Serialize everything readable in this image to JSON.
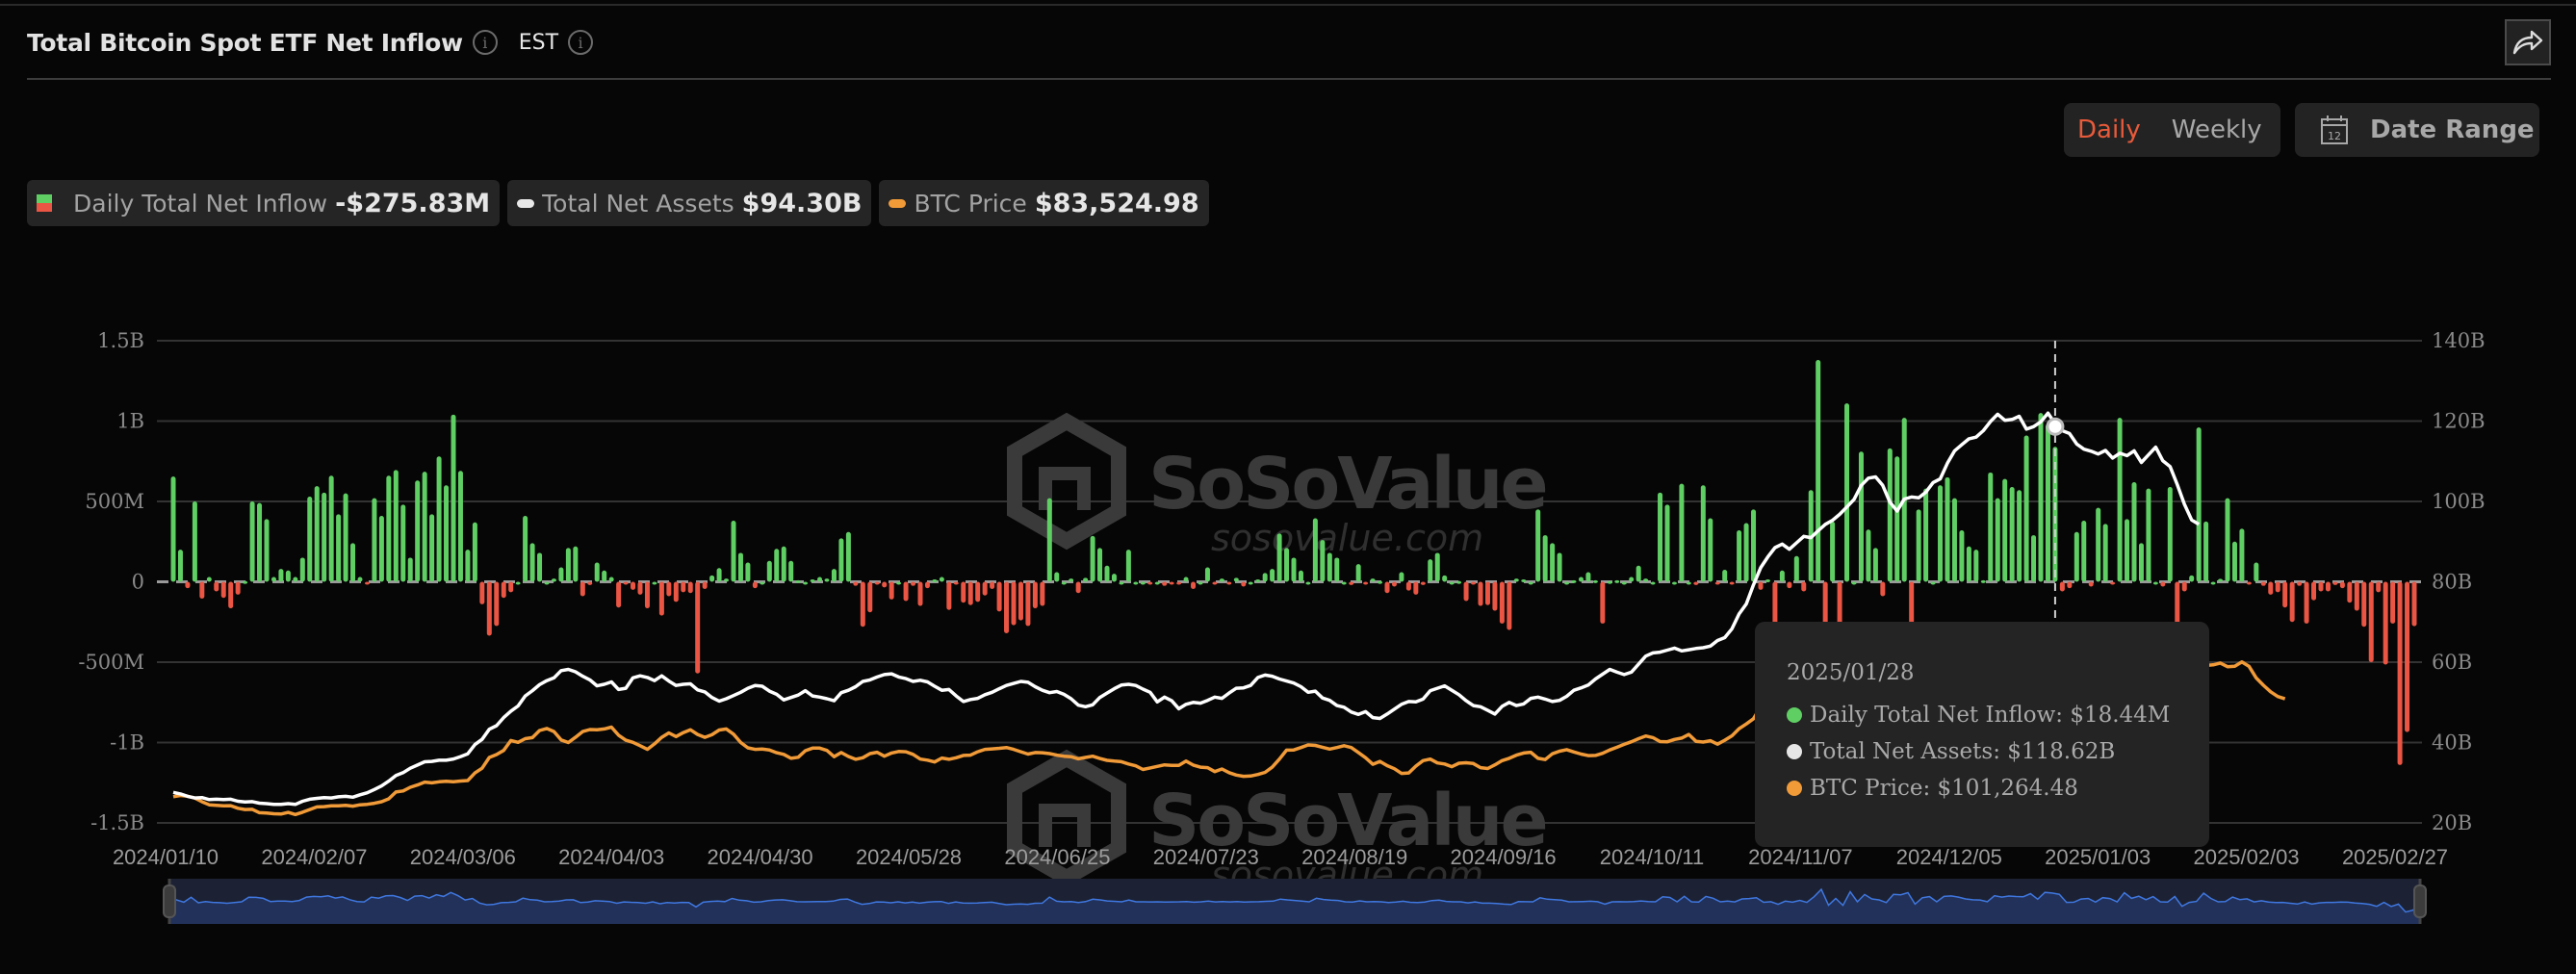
{
  "header": {
    "title": "Total Bitcoin Spot ETF Net Inflow",
    "timezone": "EST",
    "share_icon": "share-arrow-icon",
    "info_icon": "info-circle-icon"
  },
  "controls": {
    "granularity": [
      {
        "label": "Daily",
        "active": true
      },
      {
        "label": "Weekly",
        "active": false
      }
    ],
    "date_range_label": "Date Range",
    "date_range_icon": "calendar-icon"
  },
  "legend": [
    {
      "label": "Daily Total Net Inflow",
      "value": "-$275.83M"
    },
    {
      "label": "Total Net Assets",
      "value": "$94.30B"
    },
    {
      "label": "BTC Price",
      "value": "$83,524.98"
    }
  ],
  "colors": {
    "inflow_positive": "#5fcf64",
    "inflow_negative": "#ea5544",
    "total_net_assets": "#ffffff",
    "btc_price": "#f19a38",
    "active_toggle": "#e85a3a",
    "minimap_fill": "#223159",
    "minimap_line": "#3f77e0"
  },
  "tooltip": {
    "date": "2025/01/28",
    "rows": [
      {
        "label": "Daily Total Net Inflow: $18.44M",
        "color": "#5fcf64"
      },
      {
        "label": "Total Net Assets: $118.62B",
        "color": "#e6e6e6"
      },
      {
        "label": "BTC Price: $101,264.48",
        "color": "#f19a38"
      }
    ]
  },
  "watermark": {
    "brand": "SoSoValue",
    "url": "sosovalue.com"
  },
  "chart_data": {
    "type": "bar",
    "title": "Total Bitcoin Spot ETF Net Inflow",
    "x_tick_labels": [
      "2024/01/10",
      "2024/02/07",
      "2024/03/06",
      "2024/04/03",
      "2024/04/30",
      "2024/05/28",
      "2024/06/25",
      "2024/07/23",
      "2024/08/19",
      "2024/09/16",
      "2024/10/11",
      "2024/11/07",
      "2024/12/05",
      "2025/01/03",
      "2025/02/03",
      "2025/02/27"
    ],
    "y_left": {
      "label": "Daily Total Net Inflow",
      "ticks": [
        "1.5B",
        "1B",
        "500M",
        "0",
        "-500M",
        "-1B",
        "-1.5B"
      ],
      "range_millions": [
        -1500,
        1500
      ]
    },
    "y_right": {
      "label": "Total Net Assets",
      "ticks": [
        "140B",
        "120B",
        "100B",
        "80B",
        "60B",
        "40B",
        "20B"
      ],
      "range_billions": [
        20,
        140
      ]
    },
    "btc_price_axis_range_usd": [
      36100,
      220400
    ],
    "grid": true,
    "legend_position": "top-left",
    "highlight": {
      "date": "2025/01/28",
      "inflow_millions": 18.44,
      "total_net_assets_billions": 118.62,
      "btc_price_usd": 101264.48,
      "index": 262
    },
    "series": [
      {
        "name": "Daily Total Net Inflow",
        "type": "bar",
        "unit": "USD millions",
        "values": [
          655,
          200,
          -40,
          500,
          -105,
          30,
          -60,
          -100,
          -165,
          -80,
          5,
          500,
          490,
          390,
          30,
          80,
          70,
          30,
          150,
          530,
          595,
          555,
          660,
          420,
          550,
          240,
          30,
          -10,
          520,
          410,
          660,
          695,
          480,
          150,
          630,
          685,
          420,
          780,
          600,
          1040,
          690,
          200,
          370,
          -140,
          -335,
          -275,
          -100,
          -65,
          0,
          410,
          240,
          180,
          0,
          20,
          90,
          210,
          220,
          -90,
          -20,
          120,
          70,
          30,
          -160,
          -15,
          -50,
          -80,
          -165,
          0,
          -210,
          -90,
          -125,
          -65,
          -70,
          -570,
          -45,
          40,
          85,
          20,
          380,
          180,
          120,
          -40,
          0,
          130,
          205,
          220,
          130,
          10,
          0,
          15,
          30,
          20,
          80,
          270,
          310,
          -25,
          -280,
          -190,
          -15,
          -35,
          -110,
          0,
          -120,
          -25,
          -150,
          -40,
          15,
          30,
          -175,
          -15,
          -130,
          -145,
          -125,
          -85,
          -45,
          -185,
          -320,
          -270,
          -240,
          -275,
          -165,
          -150,
          520,
          60,
          0,
          20,
          -70,
          25,
          285,
          210,
          100,
          50,
          0,
          200,
          0,
          0,
          -15,
          0,
          -25,
          -15,
          -5,
          30,
          -45,
          0,
          90,
          -15,
          20,
          -10,
          25,
          -30,
          0,
          15,
          55,
          80,
          300,
          210,
          150,
          70,
          0,
          395,
          260,
          180,
          150,
          0,
          -20,
          110,
          -5,
          20,
          5,
          -70,
          -30,
          60,
          -55,
          -80,
          -20,
          140,
          180,
          40,
          0,
          5,
          -120,
          -10,
          -150,
          -145,
          -180,
          -260,
          -300,
          20,
          15,
          0,
          450,
          290,
          240,
          180,
          0,
          10,
          30,
          60,
          10,
          -260,
          5,
          10,
          0,
          30,
          100,
          20,
          0,
          555,
          480,
          0,
          610,
          0,
          -20,
          600,
          395,
          -5,
          75,
          -10,
          320,
          365,
          450,
          -50,
          15,
          -280,
          70,
          -40,
          160,
          -60,
          570,
          1380,
          -370,
          375,
          -400,
          1110,
          0,
          810,
          325,
          210,
          -90,
          830,
          780,
          1020,
          -260,
          450,
          580,
          0,
          600,
          650,
          520,
          320,
          220,
          200,
          10,
          680,
          520,
          640,
          590,
          570,
          910,
          290,
          1050,
          980,
          840,
          -60,
          -40,
          310,
          380,
          -30,
          460,
          360,
          -10,
          1020,
          390,
          620,
          240,
          580,
          0,
          -30,
          590,
          -500,
          -60,
          40,
          960,
          375,
          0,
          18.44,
          520,
          250,
          330,
          -10,
          120,
          -25,
          -80,
          -65,
          -160,
          -250,
          -25,
          -260,
          -115,
          -60,
          -60,
          -20,
          -40,
          -130,
          -180,
          -280,
          -500,
          -65,
          -515,
          -260,
          -1140,
          -935,
          -275.83
        ]
      },
      {
        "name": "Total Net Assets",
        "type": "line",
        "axis": "right",
        "unit": "USD billions",
        "values": [
          27.6,
          27.2,
          26.6,
          26.2,
          26.3,
          25.8,
          25.9,
          25.8,
          25.9,
          25.4,
          25.2,
          25.3,
          24.9,
          24.8,
          24.6,
          24.6,
          24.8,
          24.6,
          25.4,
          25.9,
          26.1,
          26.3,
          26.2,
          26.5,
          26.6,
          26.4,
          27.0,
          27.5,
          28.3,
          29.2,
          30.4,
          31.8,
          32.5,
          33.6,
          34.4,
          35.2,
          35.3,
          35.6,
          35.6,
          35.9,
          36.5,
          37.2,
          39.5,
          40.8,
          43.3,
          44.2,
          46.2,
          47.8,
          49.1,
          51.6,
          52.9,
          54.4,
          55.4,
          56.1,
          57.9,
          58.2,
          57.6,
          56.5,
          55.6,
          54.1,
          54.5,
          55.1,
          53.2,
          53.5,
          56.1,
          56.6,
          56.2,
          55.4,
          56.6,
          55.3,
          54.2,
          54.5,
          54.6,
          53.1,
          52.6,
          51.2,
          50.3,
          50.9,
          51.7,
          52.5,
          53.5,
          54.2,
          54.0,
          52.8,
          52.0,
          50.6,
          51.2,
          51.8,
          52.9,
          51.6,
          51.3,
          50.9,
          50.4,
          52.4,
          53.0,
          53.9,
          55.2,
          55.6,
          56.3,
          56.9,
          57.1,
          56.3,
          55.9,
          55.2,
          55.5,
          55.1,
          54.0,
          53.0,
          53.2,
          51.6,
          50.2,
          50.7,
          51.0,
          51.9,
          52.5,
          53.4,
          54.2,
          54.7,
          55.2,
          55.0,
          53.9,
          53.0,
          52.4,
          52.7,
          52.0,
          50.9,
          49.3,
          48.9,
          49.4,
          51.2,
          52.3,
          53.4,
          54.3,
          54.5,
          54.2,
          53.3,
          52.5,
          50.1,
          51.3,
          50.4,
          48.4,
          49.5,
          50.0,
          49.8,
          50.5,
          51.3,
          51.0,
          52.3,
          53.5,
          53.6,
          54.2,
          56.2,
          56.8,
          56.5,
          55.8,
          55.3,
          54.8,
          53.9,
          52.5,
          52.8,
          51.1,
          50.5,
          49.2,
          48.8,
          47.6,
          47.0,
          47.7,
          46.2,
          46.0,
          47.1,
          48.3,
          49.5,
          50.2,
          50.1,
          50.8,
          52.9,
          53.5,
          54.1,
          53.0,
          51.9,
          50.4,
          49.2,
          48.9,
          48.0,
          47.1,
          49.0,
          50.0,
          49.2,
          49.6,
          51.0,
          51.3,
          50.8,
          50.2,
          50.5,
          51.5,
          53.0,
          53.6,
          54.3,
          55.8,
          57.0,
          58.2,
          57.5,
          56.9,
          57.5,
          59.5,
          61.5,
          62.3,
          62.5,
          63.0,
          63.5,
          62.8,
          63.1,
          63.4,
          63.6,
          64.0,
          65.4,
          66.1,
          68.3,
          72.0,
          74.5,
          79.2,
          83.5,
          86.2,
          88.5,
          89.4,
          88.1,
          89.7,
          91.3,
          91.0,
          92.7,
          94.3,
          95.3,
          96.8,
          98.6,
          100.5,
          104.0,
          105.8,
          106.1,
          104.0,
          99.8,
          97.6,
          100.6,
          101.1,
          100.9,
          102.3,
          104.7,
          105.6,
          109.5,
          112.6,
          114.1,
          115.6,
          116.0,
          117.6,
          119.9,
          121.7,
          120.2,
          120.4,
          121.2,
          118.0,
          118.62,
          119.8,
          122.0,
          119.3,
          117.6,
          116.9,
          114.3,
          113.0,
          112.5,
          111.8,
          112.7,
          110.8,
          112.0,
          111.4,
          112.6,
          109.7,
          111.6,
          113.5,
          110.1,
          108.7,
          104.2,
          99.3,
          95.4,
          94.3
        ]
      },
      {
        "name": "BTC Price",
        "type": "line",
        "axis": "right-scaled",
        "unit": "USD",
        "values": [
          46100,
          46600,
          46300,
          45600,
          44200,
          43000,
          42800,
          42600,
          42700,
          41700,
          41200,
          41300,
          40000,
          39900,
          39600,
          39500,
          40100,
          39300,
          40200,
          41200,
          42200,
          42300,
          42600,
          42600,
          42800,
          42500,
          43000,
          43200,
          43600,
          44200,
          45300,
          47900,
          48300,
          49700,
          50600,
          51700,
          51400,
          51800,
          52000,
          51800,
          52100,
          52300,
          55200,
          57000,
          61100,
          62200,
          63800,
          67600,
          66900,
          68300,
          68700,
          71400,
          72200,
          71000,
          67800,
          66800,
          68800,
          71000,
          71800,
          71700,
          72000,
          72700,
          69600,
          67700,
          66900,
          65600,
          64200,
          66300,
          68800,
          70500,
          69100,
          70600,
          71700,
          69900,
          68800,
          69800,
          71600,
          72000,
          70000,
          66800,
          64800,
          64200,
          64300,
          64000,
          62900,
          62300,
          60800,
          61200,
          63700,
          64700,
          64700,
          63800,
          61400,
          63000,
          61500,
          60400,
          61000,
          62600,
          63100,
          61600,
          62800,
          63400,
          63300,
          62300,
          60500,
          60100,
          59400,
          60900,
          60400,
          61000,
          61900,
          62000,
          63300,
          64200,
          64400,
          64600,
          64900,
          64200,
          63300,
          62400,
          63000,
          62900,
          62600,
          62000,
          61600,
          61400,
          60600,
          61100,
          61600,
          60700,
          60000,
          59700,
          59500,
          58600,
          57900,
          56500,
          57100,
          57700,
          58300,
          58100,
          58100,
          59700,
          58200,
          57400,
          57200,
          55700,
          56700,
          55300,
          54400,
          53900,
          54000,
          54600,
          55400,
          57400,
          60500,
          63900,
          64000,
          64900,
          65900,
          65700,
          65000,
          64300,
          64900,
          65600,
          64900,
          63000,
          61000,
          58500,
          59600,
          58000,
          56800,
          55000,
          55200,
          57800,
          59900,
          60500,
          59000,
          58600,
          57600,
          58900,
          59100,
          58800,
          57200,
          56900,
          58300,
          59900,
          60800,
          62000,
          62800,
          63100,
          60800,
          60300,
          62500,
          63500,
          64100,
          63200,
          62400,
          61800,
          61900,
          62700,
          64000,
          65000,
          66100,
          67100,
          68300,
          69300,
          68700,
          67200,
          67100,
          68000,
          68500,
          69900,
          67300,
          67000,
          67500,
          66200,
          67700,
          69400,
          72100,
          73900,
          75900,
          80400,
          85700,
          87900,
          89800,
          91000,
          90800,
          92600,
          94200,
          95800,
          97800,
          98300,
          98700,
          96900,
          95400,
          96400,
          97400,
          99700,
          100200,
          98900,
          96500,
          97000,
          99400,
          97500,
          101500,
          106200,
          105500,
          104500,
          101700,
          97800,
          94700,
          93000,
          95300,
          96700,
          93400,
          94400,
          98200,
          101600,
          102700,
          97500,
          94500,
          96000,
          94200,
          96200,
          99700,
          104300,
          106100,
          105000,
          104700,
          101264.48,
          102400,
          104700,
          104700,
          101300,
          100700,
          98200,
          97400,
          97400,
          96600,
          97600,
          96600,
          95800,
          97500,
          96300,
          96500,
          97200,
          95800,
          96000,
          97600,
          95900,
          91500,
          88700,
          86200,
          84400,
          83524.98
        ]
      }
    ]
  }
}
